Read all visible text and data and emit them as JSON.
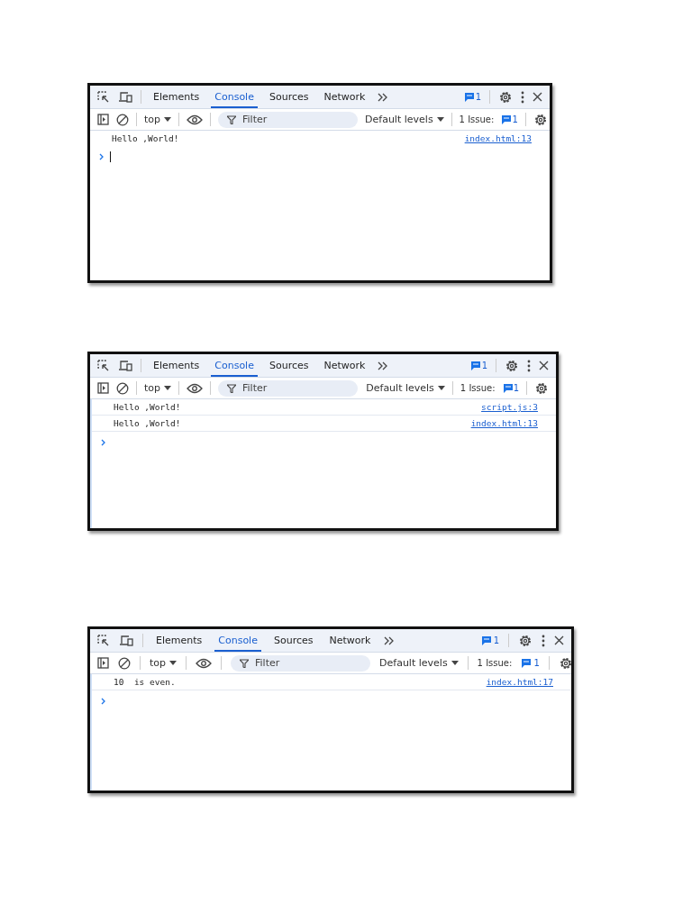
{
  "screenshots": [
    {
      "tabs": [
        {
          "label": "Elements",
          "selected": false
        },
        {
          "label": "Console",
          "selected": true
        },
        {
          "label": "Sources",
          "selected": false
        },
        {
          "label": "Network",
          "selected": false
        }
      ],
      "issue_badge": "1",
      "context": "top",
      "filter": {
        "placeholder": "Filter"
      },
      "levels": "Default levels",
      "issues_label": "1 Issue:",
      "issues_count": "1",
      "messages": [
        {
          "text": "Hello ,World!",
          "source": "index.html:13"
        }
      ],
      "cursor": true
    },
    {
      "tabs": [
        {
          "label": "Elements",
          "selected": false
        },
        {
          "label": "Console",
          "selected": true
        },
        {
          "label": "Sources",
          "selected": false
        },
        {
          "label": "Network",
          "selected": false
        }
      ],
      "issue_badge": "1",
      "context": "top",
      "filter": {
        "placeholder": "Filter"
      },
      "levels": "Default levels",
      "issues_label": "1 Issue:",
      "issues_count": "1",
      "messages": [
        {
          "text": "Hello ,World!",
          "source": "script.js:3"
        },
        {
          "text": "Hello ,World!",
          "source": "index.html:13"
        }
      ],
      "cursor": false
    },
    {
      "tabs": [
        {
          "label": "Elements",
          "selected": false
        },
        {
          "label": "Console",
          "selected": true
        },
        {
          "label": "Sources",
          "selected": false
        },
        {
          "label": "Network",
          "selected": false
        }
      ],
      "issue_badge": "1",
      "context": "top",
      "filter": {
        "placeholder": "Filter"
      },
      "levels": "Default levels",
      "issues_label": "1 Issue:",
      "issues_count": "1",
      "messages": [
        {
          "text": "10  is even.",
          "source": "index.html:17"
        }
      ],
      "cursor": false
    }
  ]
}
